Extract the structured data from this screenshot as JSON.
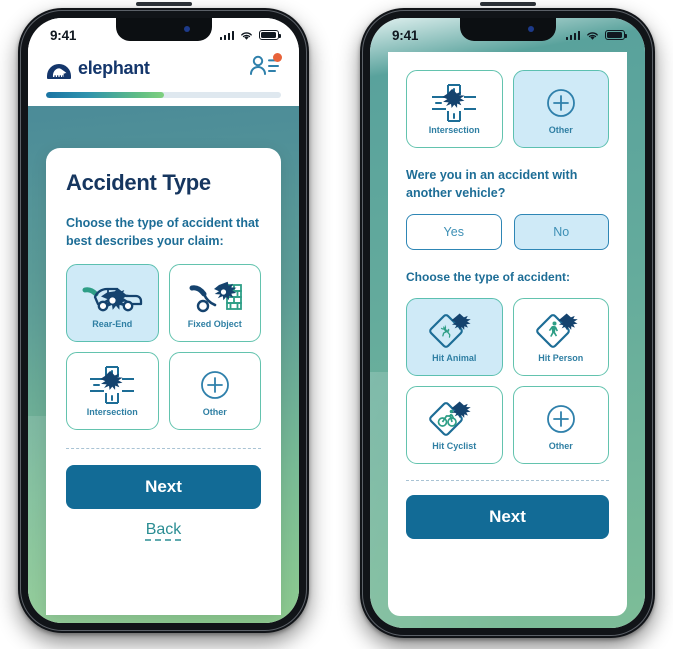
{
  "colors": {
    "brand_navy": "#14366b",
    "teal_border": "#63c3ae",
    "tile_selected_bg": "#cfeaf7",
    "primary_button": "#126b96",
    "link_teal": "#2b8d93",
    "heading_navy": "#16365f",
    "subtext_blue": "#1d6d96",
    "notif_orange": "#e8633a",
    "progress_start": "#1a74a3",
    "progress_end": "#80d07f",
    "bg_gradient_top": "#4b8b98",
    "bg_gradient_bottom": "#8ecb90"
  },
  "status_bar": {
    "time": "9:41",
    "signal_icon": "cellular-bars-icon",
    "wifi_icon": "wifi-icon",
    "battery_icon": "battery-icon"
  },
  "left_phone": {
    "header": {
      "logo_icon": "elephant-logo-icon",
      "brand_name": "elephant",
      "account_icon": "account-list-icon",
      "notification_badge": "notification-dot",
      "progress_percent": 50
    },
    "card": {
      "title": "Accident Type",
      "subtitle": "Choose the type of accident that best describes your claim:",
      "tiles": [
        {
          "label": "Rear-End",
          "icon": "car-rear-end-impact-icon",
          "selected": true
        },
        {
          "label": "Fixed Object",
          "icon": "car-fixed-object-impact-icon",
          "selected": false
        },
        {
          "label": "Intersection",
          "icon": "intersection-impact-icon",
          "selected": false
        },
        {
          "label": "Other",
          "icon": "plus-circle-icon",
          "selected": false
        }
      ],
      "next_label": "Next",
      "back_label": "Back"
    }
  },
  "right_phone": {
    "top_tiles": [
      {
        "label": "Intersection",
        "icon": "intersection-impact-icon",
        "selected": false
      },
      {
        "label": "Other",
        "icon": "plus-circle-icon",
        "selected": true
      }
    ],
    "question": "Were you in an accident with another vehicle?",
    "answers": [
      {
        "label": "Yes",
        "selected": false
      },
      {
        "label": "No",
        "selected": true
      }
    ],
    "section_label": "Choose the type of accident:",
    "type_tiles": [
      {
        "label": "Hit Animal",
        "icon": "deer-crossing-sign-impact-icon",
        "selected": true
      },
      {
        "label": "Hit Person",
        "icon": "pedestrian-crossing-sign-impact-icon",
        "selected": false
      },
      {
        "label": "Hit Cyclist",
        "icon": "bicycle-crossing-sign-impact-icon",
        "selected": false
      },
      {
        "label": "Other",
        "icon": "plus-circle-icon",
        "selected": false
      }
    ],
    "next_label": "Next"
  }
}
